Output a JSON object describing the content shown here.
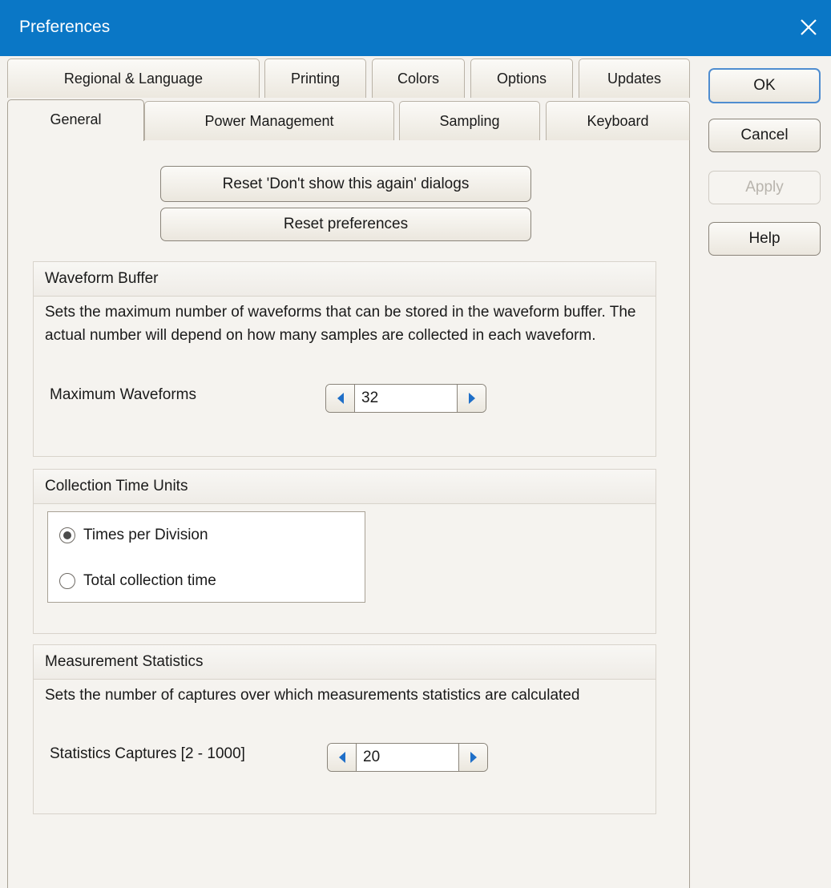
{
  "window": {
    "title": "Preferences"
  },
  "tabs": {
    "back_row": [
      "Regional & Language",
      "Printing",
      "Colors",
      "Options",
      "Updates"
    ],
    "front_row": [
      "General",
      "Power Management",
      "Sampling",
      "Keyboard"
    ],
    "active": "General"
  },
  "dialog_buttons": {
    "ok": "OK",
    "cancel": "Cancel",
    "apply": "Apply",
    "help": "Help"
  },
  "general": {
    "reset_dialogs_button": "Reset 'Don't show this again' dialogs",
    "reset_preferences_button": "Reset preferences",
    "waveform_buffer": {
      "title": "Waveform Buffer",
      "description": "Sets the maximum number of waveforms that can be stored in the waveform buffer. The actual number will depend on how many samples are collected in each waveform.",
      "field_label": "Maximum Waveforms",
      "value": "32"
    },
    "collection_time_units": {
      "title": "Collection Time Units",
      "options": [
        "Times per Division",
        "Total collection time"
      ],
      "selected": "Times per Division"
    },
    "measurement_statistics": {
      "title": "Measurement Statistics",
      "description": "Sets the number of captures over which measurements statistics are calculated",
      "field_label": "Statistics Captures [2 - 1000]",
      "value": "20"
    }
  },
  "icons": {
    "close": "close-icon",
    "decrement": "arrow-left-icon",
    "increment": "arrow-right-icon"
  },
  "colors": {
    "titlebar": "#0a77c6",
    "accent_arrow": "#1f6fc8",
    "dialog_bg": "#f4f2ee"
  }
}
